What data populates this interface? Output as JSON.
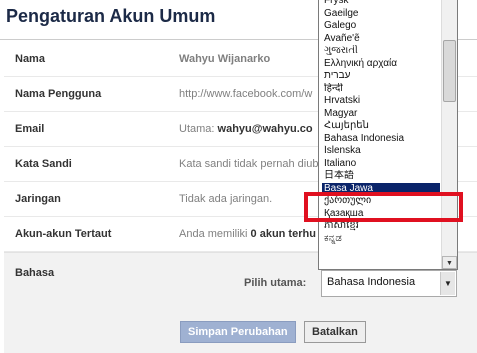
{
  "page": {
    "title": "Pengaturan Akun Umum"
  },
  "rows": [
    {
      "label": "Nama",
      "value_name": "Wahyu Wijanarko"
    },
    {
      "label": "Nama Pengguna",
      "value": "http://www.facebook.com/w"
    },
    {
      "label": "Email",
      "value_prefix": "Utama:",
      "value_bold": "wahyu@wahyu.co"
    },
    {
      "label": "Kata Sandi",
      "value": "Kata sandi tidak pernah diuba"
    },
    {
      "label": "Jaringan",
      "value": "Tidak ada jaringan."
    },
    {
      "label": "Akun-akun Tertaut",
      "value_prefix": "Anda memiliki",
      "value_bold": "0 akun terhu"
    }
  ],
  "language": {
    "label": "Bahasa",
    "primary_label": "Pilih utama:",
    "selected_value": "Bahasa Indonesia",
    "save_label": "Simpan Perubahan",
    "cancel_label": "Batalkan"
  },
  "dropdown": {
    "options": [
      "Frysk",
      "Gaeilge",
      "Galego",
      "Avañe'ẽ",
      "ગુજરાતી",
      "Ελληνική αρχαία",
      "עברית",
      "हिन्दी",
      "Hrvatski",
      "Magyar",
      "Հայերեն",
      "Bahasa Indonesia",
      "Íslenska",
      "Italiano",
      "日本語",
      "Basa Jawa",
      "ქართული",
      "Қазақша",
      "ភាសាខ្មែរ",
      "ಕನ್ನಡ"
    ],
    "highlighted": "Basa Jawa",
    "highlight_color": "#e01020",
    "selected_bg": "#0a246a"
  }
}
